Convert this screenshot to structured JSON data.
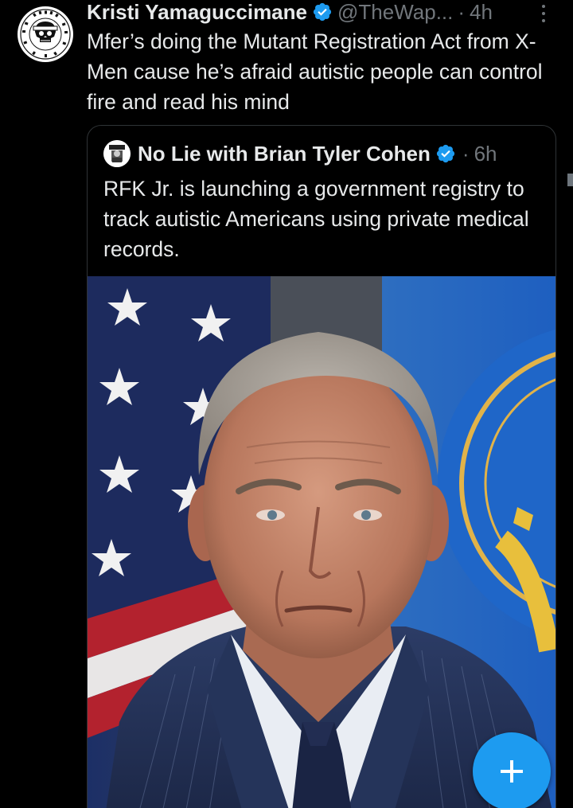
{
  "tweet": {
    "author": {
      "display_name": "Kristi Yamaguccimane",
      "handle": "@TheWap...",
      "verified": true,
      "avatar_icon": "skull-bandana-badge-avatar",
      "avatar_ring_text": "RAISE HELL TRADE DAILY BROTHER PPLCOBL"
    },
    "separator": "·",
    "timestamp": "4h",
    "text": "Mfer’s doing the Mutant Registration Act from X-Men cause he’s afraid autistic people can control fire and read his mind",
    "more_icon": "more-vertical-icon"
  },
  "quote": {
    "author": {
      "display_name": "No Lie with Brian Tyler Cohen",
      "verified": true,
      "avatar_icon": "no-lie-logo-avatar",
      "avatar_text": "NO LIE"
    },
    "separator": "·",
    "timestamp": "6h",
    "text": "RFK Jr. is launching a government registry to track autistic Americans using private medical records.",
    "media": {
      "kind": "photo",
      "subject": "portrait-man-in-suit-before-flag"
    }
  },
  "fab": {
    "label": "+",
    "icon": "compose-plus-icon"
  },
  "colors": {
    "background": "#000000",
    "text_primary": "#e7e9ea",
    "text_secondary": "#71767b",
    "verified_blue": "#1d9bf0",
    "border": "#2f3336",
    "fab": "#1d9bf0"
  }
}
